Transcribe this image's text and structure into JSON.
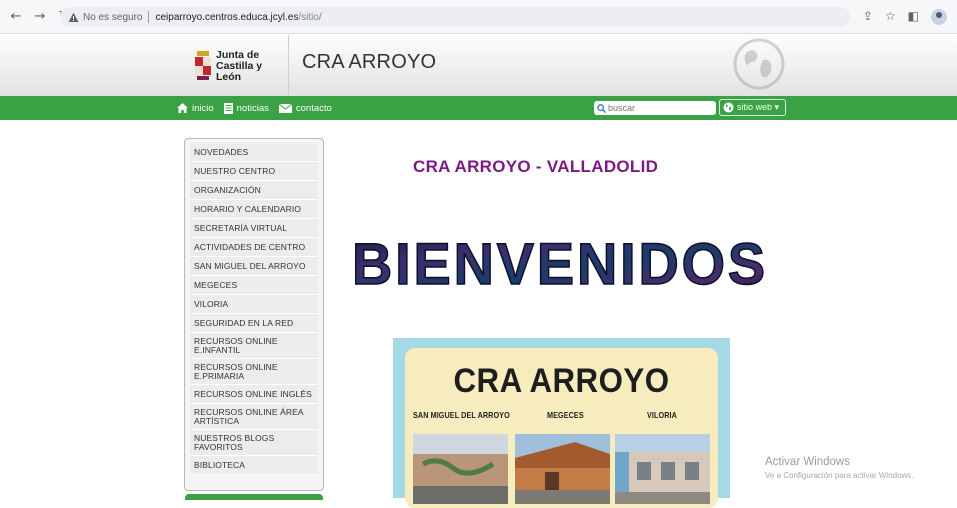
{
  "browser": {
    "not_secure_label": "No es seguro",
    "url_host": "ceiparroyo.centros.educa.jcyl.es",
    "url_path": "/sitio/"
  },
  "header": {
    "logo_line1": "Junta de",
    "logo_line2": "Castilla y León",
    "site_title": "CRA ARROYO"
  },
  "nav": {
    "links": [
      "inicio",
      "noticias",
      "contacto"
    ],
    "search_placeholder": "buscar",
    "siteweb_label": "sitio web ▾"
  },
  "sidebar": {
    "items": [
      "NOVEDADES",
      "NUESTRO CENTRO",
      "ORGANIZACIÓN",
      "HORARIO Y CALENDARIO",
      "SECRETARÍA VIRTUAL",
      "ACTIVIDADES DE CENTRO",
      "SAN MIGUEL DEL ARROYO",
      "MEGECES",
      "VILORIA",
      "SEGURIDAD EN LA RED",
      "RECURSOS ONLINE\nE.INFANTIL",
      "RECURSOS ONLINE\nE.PRIMARIA",
      "RECURSOS ONLINE INGLÉS",
      "RECURSOS ONLINE ÁREA\nARTÍSTICA",
      "NUESTROS BLOGS\nFAVORITOS",
      "BIBLIOTECA"
    ]
  },
  "main": {
    "title": "CRA ARROYO - VALLADOLID",
    "welcome": "BIENVENIDOS",
    "poster": {
      "title": "CRA ARROYO",
      "locations": [
        "SAN MIGUEL DEL ARROYO",
        "MEGECES",
        "VILORIA"
      ]
    }
  },
  "watermark": {
    "title": "Activar Windows",
    "subtitle": "Ve a Configuración para activar Windows."
  },
  "colors": {
    "nav_green": "#3aa145",
    "title_purple": "#7b1a82"
  }
}
